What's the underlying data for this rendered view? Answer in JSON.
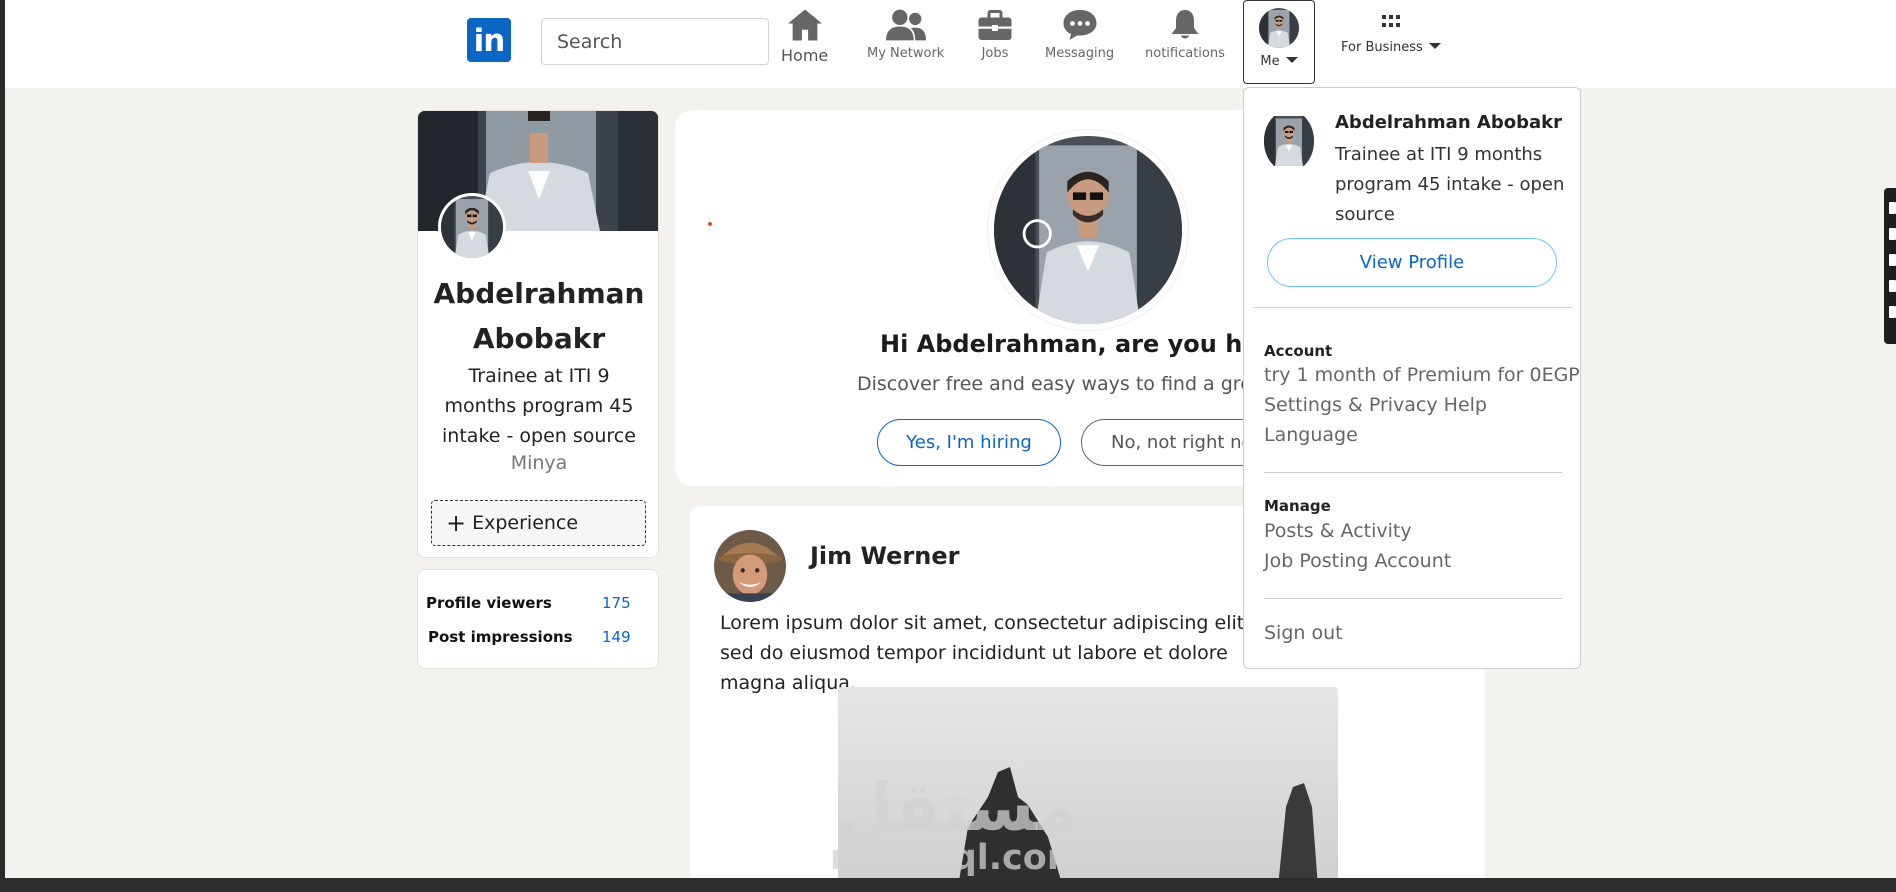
{
  "header": {
    "logo_text": "in",
    "search_placeholder": "Search",
    "nav": {
      "home": "Home",
      "network": "My Network",
      "jobs": "Jobs",
      "messaging": "Messaging",
      "notifications": "notifications",
      "me": "Me",
      "business": "For Business"
    }
  },
  "profile": {
    "name": "Abdelrahman Abobakr",
    "headline": "Trainee at ITI 9 months program 45 intake - open source",
    "location": "Minya",
    "experience_button": "Experience",
    "stats": [
      {
        "label": "Profile viewers",
        "value": "175"
      },
      {
        "label": "Post impressions",
        "value": "149"
      }
    ]
  },
  "hiring": {
    "title": "Hi Abdelrahman, are you hiring?",
    "subtitle": "Discover free and easy ways to find a great hire",
    "yes_label": "Yes, I'm hiring",
    "no_label": "No, not right now"
  },
  "post": {
    "author": "Jim Werner",
    "text": "Lorem ipsum dolor sit amet, consectetur adipiscing elit, sed do eiusmod tempor incididunt ut labore et dolore magna aliqua."
  },
  "watermark": {
    "arabic": "مستقل",
    "latin": "mostaql.com"
  },
  "dropdown": {
    "name": "Abdelrahman Abobakr",
    "headline": "Trainee at ITI 9 months program 45 intake - open source",
    "view_profile": "View Profile",
    "account_title": "Account",
    "account_items": [
      "try 1 month of Premium for 0EGP",
      "Settings & Privacy Help",
      "Language"
    ],
    "manage_title": "Manage",
    "manage_items": [
      "Posts & Activity",
      "Job Posting Account"
    ],
    "sign_out": "Sign out"
  },
  "colors": {
    "brand": "#0a66c2",
    "page_bg": "#f4f2ee"
  }
}
